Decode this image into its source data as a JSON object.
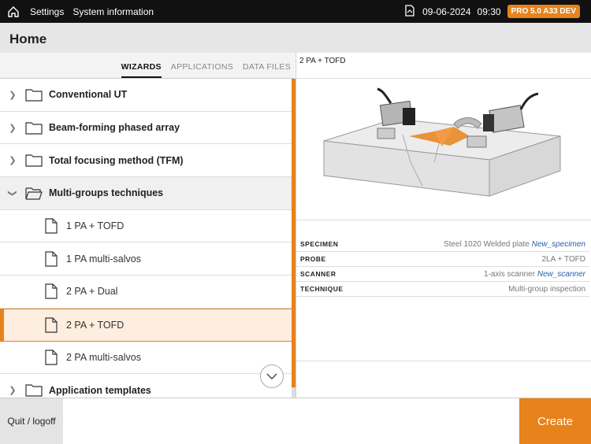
{
  "topbar": {
    "settings": "Settings",
    "system_info": "System information",
    "date": "09-06-2024",
    "time": "09:30",
    "version": "PRO 5.0 A33 DEV"
  },
  "header": {
    "title": "Home"
  },
  "tabs": [
    {
      "label": "WIZARDS",
      "active": true
    },
    {
      "label": "APPLICATIONS",
      "active": false
    },
    {
      "label": "DATA FILES",
      "active": false
    }
  ],
  "list": {
    "items": [
      {
        "label": "Conventional UT"
      },
      {
        "label": "Beam-forming phased array"
      },
      {
        "label": "Total focusing method (TFM)"
      },
      {
        "label": "Multi-groups techniques"
      },
      {
        "label": "1 PA + TOFD"
      },
      {
        "label": "1 PA multi-salvos"
      },
      {
        "label": "2 PA + Dual"
      },
      {
        "label": "2 PA + TOFD"
      },
      {
        "label": "2 PA multi-salvos"
      },
      {
        "label": "Application templates"
      }
    ]
  },
  "detail": {
    "title": "2 PA + TOFD",
    "rows": [
      {
        "key": "SPECIMEN",
        "value": "Steel 1020 Welded plate",
        "link": "New_specimen"
      },
      {
        "key": "PROBE",
        "value": "2LA + TOFD",
        "link": ""
      },
      {
        "key": "SCANNER",
        "value": "1-axis scanner",
        "link": "New_scanner"
      },
      {
        "key": "TECHNIQUE",
        "value": "Multi-group inspection",
        "link": ""
      }
    ]
  },
  "bottom": {
    "quit": "Quit / logoff",
    "create": "Create"
  },
  "colors": {
    "accent": "#e8821a",
    "topbar": "#111111"
  }
}
